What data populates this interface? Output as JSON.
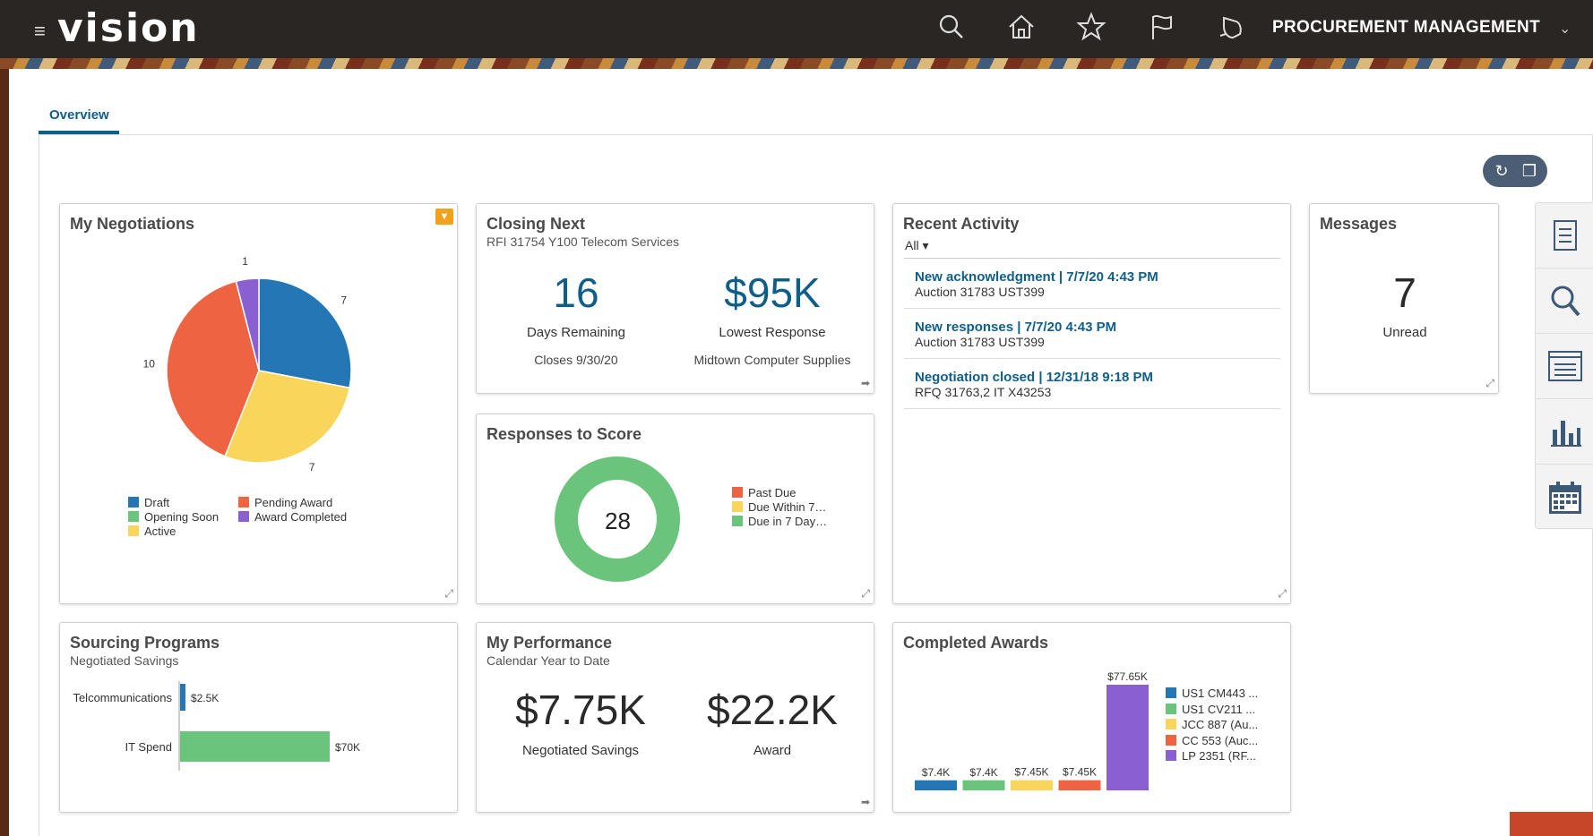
{
  "header": {
    "menu_icon": "hamburger-icon",
    "logo": "vision",
    "icons": [
      "search-icon",
      "home-icon",
      "star-icon",
      "flag-icon",
      "bell-icon"
    ],
    "app_title": "PROCUREMENT MANAGEMENT",
    "app_chevron": "chevron-down-icon"
  },
  "tabs": [
    {
      "label": "Overview",
      "active": true
    }
  ],
  "controls": {
    "refresh_icon": "refresh-icon",
    "copy_icon": "copy-icon"
  },
  "my_negotiations": {
    "title": "My Negotiations",
    "chart_data": {
      "type": "pie",
      "slices": [
        {
          "label": "Draft",
          "value": 7,
          "color": "#2477b4"
        },
        {
          "label": "Active",
          "value": 7,
          "color": "#f9d65b"
        },
        {
          "label": "Pending Award",
          "value": 10,
          "color": "#ee6443"
        },
        {
          "label": "Award Completed",
          "value": 1,
          "color": "#8a5fd1"
        }
      ],
      "legend": [
        {
          "label": "Draft",
          "color": "#2477b4"
        },
        {
          "label": "Pending Award",
          "color": "#ee6443"
        },
        {
          "label": "Opening Soon",
          "color": "#6bc47b"
        },
        {
          "label": "Award Completed",
          "color": "#8a5fd1"
        },
        {
          "label": "Active",
          "color": "#f9d65b"
        }
      ]
    }
  },
  "closing_next": {
    "title": "Closing Next",
    "subtitle": "RFI 31754 Y100 Telecom Services",
    "days_value": "16",
    "days_label": "Days Remaining",
    "closes": "Closes 9/30/20",
    "response_value": "$95K",
    "response_label": "Lowest Response",
    "supplier": "Midtown Computer Supplies"
  },
  "recent_activity": {
    "title": "Recent Activity",
    "filter": "All",
    "items": [
      {
        "link": "New acknowledgment | 7/7/20 4:43 PM",
        "desc": "Auction 31783 UST399"
      },
      {
        "link": "New responses | 7/7/20 4:43 PM",
        "desc": "Auction 31783 UST399"
      },
      {
        "link": "Negotiation closed | 12/31/18 9:18 PM",
        "desc": "RFQ 31763,2 IT X43253"
      }
    ]
  },
  "messages": {
    "title": "Messages",
    "value": "7",
    "label": "Unread"
  },
  "responses_to_score": {
    "title": "Responses to Score",
    "center_value": "28",
    "chart_data": {
      "type": "pie",
      "slices": [
        {
          "label": "Due in 7 Day…",
          "value": 28,
          "color": "#6bc47b"
        }
      ],
      "legend": [
        {
          "label": "Past Due",
          "color": "#ee6443"
        },
        {
          "label": "Due Within 7…",
          "color": "#f9d65b"
        },
        {
          "label": "Due in 7 Day…",
          "color": "#6bc47b"
        }
      ]
    }
  },
  "sourcing_programs": {
    "title": "Sourcing Programs",
    "subtitle": "Negotiated Savings",
    "chart_data": {
      "type": "bar",
      "orientation": "horizontal",
      "categories": [
        "Telcommunications",
        "IT Spend"
      ],
      "values": [
        2.5,
        70
      ],
      "value_labels": [
        "$2.5K",
        "$70K"
      ],
      "colors": [
        "#2477b4",
        "#6bc47b"
      ],
      "xlim": [
        0,
        70
      ]
    }
  },
  "my_performance": {
    "title": "My Performance",
    "subtitle": "Calendar Year to Date",
    "savings_value": "$7.75K",
    "savings_label": "Negotiated Savings",
    "award_value": "$22.2K",
    "award_label": "Award"
  },
  "completed_awards": {
    "title": "Completed Awards",
    "chart_data": {
      "type": "bar",
      "categories": [
        "US1 CM443 ...",
        "US1 CV211 ...",
        "JCC 887 (Au...",
        "CC 553 (Auc...",
        "LP 2351 (RF..."
      ],
      "values": [
        7.4,
        7.4,
        7.45,
        7.45,
        77.65
      ],
      "value_labels": [
        "$7.4K",
        "$7.4K",
        "$7.45K",
        "$7.45K",
        "$77.65K"
      ],
      "colors": [
        "#2477b4",
        "#6bc47b",
        "#f9d65b",
        "#ee6443",
        "#8a5fd1"
      ],
      "ylim": [
        0,
        77.65
      ]
    }
  },
  "side_panel": {
    "icons": [
      "document-icon",
      "search-icon",
      "list-icon",
      "bar-chart-icon",
      "calendar-icon"
    ]
  }
}
